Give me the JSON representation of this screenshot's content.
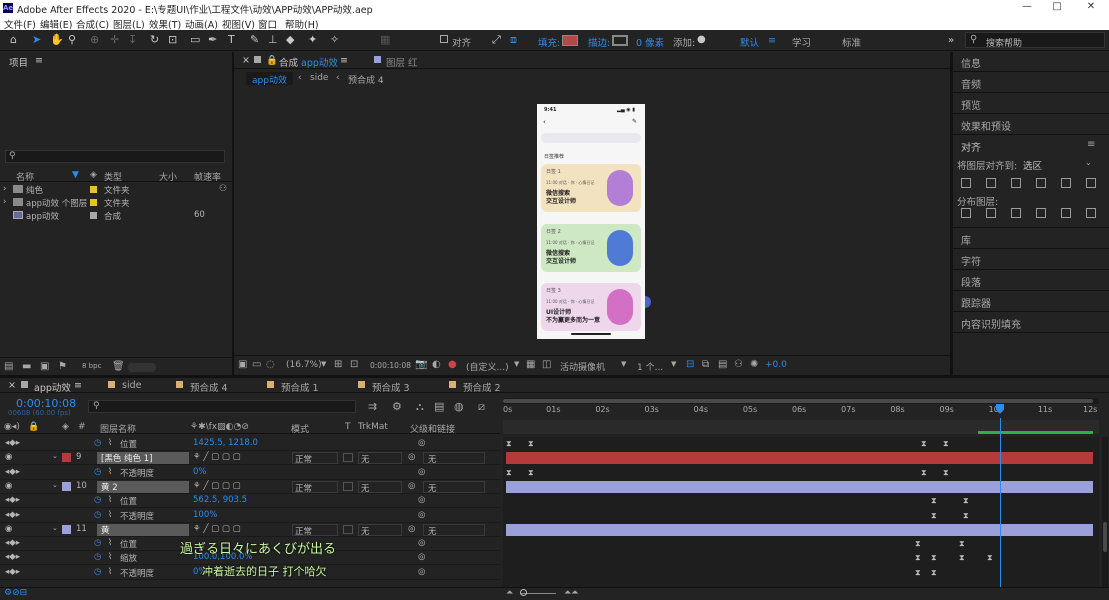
{
  "app": {
    "icon": "Ae",
    "title": "Adobe After Effects 2020 - E:\\专题UI\\作业\\工程文件\\动效\\APP动效\\APP动效.aep"
  },
  "window_controls": {
    "minimize": "—",
    "maximize": "□",
    "close": "✕"
  },
  "menu": [
    "文件(F)",
    "编辑(E)",
    "合成(C)",
    "图层(L)",
    "效果(T)",
    "动画(A)",
    "视图(V)",
    "窗口",
    "帮助(H)"
  ],
  "toolbar": {
    "align_label": "对齐",
    "fill_label": "填充:",
    "stroke_label": "描边:",
    "stroke_width": "0 像素",
    "add_label": "添加:",
    "workspaces": [
      "默认",
      "学习",
      "标准"
    ],
    "search_placeholder": "搜索帮助",
    "fill_color": "#b24a4a"
  },
  "project": {
    "title": "项目",
    "columns": {
      "name": "名称",
      "type": "类型",
      "size": "大小",
      "fps": "帧速率"
    },
    "items": [
      {
        "name": "纯色",
        "type": "文件夹",
        "size": "",
        "fps": "",
        "label": "#e6c229"
      },
      {
        "name": "app动效 个图层",
        "type": "文件夹",
        "size": "",
        "fps": "",
        "label": "#e6c229"
      },
      {
        "name": "app动效",
        "type": "合成",
        "size": "",
        "fps": "60",
        "label": "#a8a8a8"
      }
    ],
    "bpc": "8 bpc"
  },
  "comp": {
    "tab_label": "合成",
    "tab_name": "app动效",
    "layer_tab": "图层 红",
    "breadcrumb": [
      "app动效",
      "side",
      "预合成 4"
    ],
    "zoom": "(16.7%)",
    "timecode": "0:00:10:08",
    "view_mode": "(自定义...)",
    "camera": "活动摄像机",
    "views": "1 个...",
    "exposure": "+0.0"
  },
  "phone": {
    "time": "9:41",
    "section": "日签推荐",
    "cards": [
      {
        "small": "日签 1",
        "sub": "11:00 对话 · 你 · 心情日记",
        "title1": "微信搜索",
        "title2": "交互设计师",
        "color": "#f3e2bf"
      },
      {
        "small": "日签 2",
        "sub": "11:00 对话 · 你 · 心情日记",
        "title1": "微信搜索",
        "title2": "交互设计师",
        "color": "#cde8c2"
      },
      {
        "small": "日签 3",
        "sub": "11:00 对话 · 你 · 心情日记",
        "title1": "UI设计师",
        "title2": "不为赢更多而为一意",
        "color": "#eed7eb"
      }
    ]
  },
  "right_panels": [
    "信息",
    "音频",
    "预览",
    "效果和预设"
  ],
  "align_panel": {
    "title": "对齐",
    "align_to_label": "将图层对齐到:",
    "align_to_value": "选区",
    "distribute_label": "分布图层:"
  },
  "right_panels2": [
    "库",
    "字符",
    "段落",
    "跟踪器",
    "内容识别填充"
  ],
  "timeline": {
    "tabs": [
      {
        "name": "app动效",
        "color": "#a8a8a8"
      },
      {
        "name": "side",
        "color": "#d9b070"
      },
      {
        "name": "预合成 4",
        "color": "#d9b070"
      },
      {
        "name": "预合成 1",
        "color": "#d9b070"
      },
      {
        "name": "预合成 3",
        "color": "#d9b070"
      },
      {
        "name": "预合成 2",
        "color": "#d9b070"
      }
    ],
    "current_time": "0:00:10:08",
    "frame_info": "00608 (60.00 fps)",
    "columns": {
      "num": "#",
      "name": "图层名称",
      "mode": "模式",
      "t": "T",
      "trkmat": "TrkMat",
      "parent": "父级和链接"
    },
    "ruler": [
      "0s",
      "01s",
      "02s",
      "03s",
      "04s",
      "05s",
      "06s",
      "07s",
      "08s",
      "09s",
      "10s",
      "11s",
      "12s"
    ],
    "rows": [
      {
        "kind": "prop",
        "name": "位置",
        "value": "1425.5, 1218.0"
      },
      {
        "kind": "layer",
        "num": "9",
        "name": "[黑色 纯色 1]",
        "mode": "正常",
        "trkmat": "无",
        "parent": "无",
        "color": "#b53b3b"
      },
      {
        "kind": "prop",
        "name": "不透明度",
        "value": "0%"
      },
      {
        "kind": "layer",
        "num": "10",
        "name": "黄 2",
        "mode": "正常",
        "trkmat": "无",
        "parent": "无",
        "color": "#9aa0d8"
      },
      {
        "kind": "prop",
        "name": "位置",
        "value": "562.5, 903.5"
      },
      {
        "kind": "prop",
        "name": "不透明度",
        "value": "100%"
      },
      {
        "kind": "layer",
        "num": "11",
        "name": "黄",
        "mode": "正常",
        "trkmat": "无",
        "parent": "无",
        "color": "#9aa0d8"
      },
      {
        "kind": "prop",
        "name": "位置",
        "value": ""
      },
      {
        "kind": "prop",
        "name": "缩放",
        "value": "100.0,100.0%"
      },
      {
        "kind": "prop",
        "name": "不透明度",
        "value": "0%"
      }
    ],
    "subtitle_ja": "過ぎる日々にあくびが出る",
    "subtitle_zh": "冲着逝去的日子 打个哈欠"
  }
}
